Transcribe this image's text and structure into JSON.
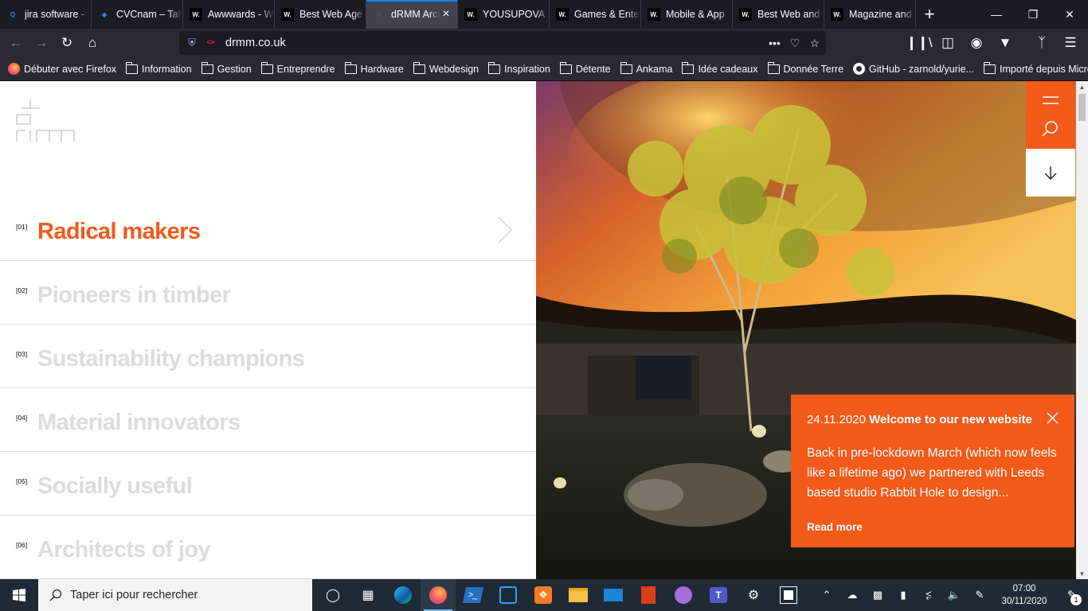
{
  "browser": {
    "tabs": [
      {
        "title": "jira software -",
        "fav_color": "#2684ff",
        "fav_text": "Q"
      },
      {
        "title": "CVCnam – Tal",
        "fav_color": "#2684ff",
        "fav_text": "◆"
      },
      {
        "title": "Awwwards - W",
        "fav_color": "#222222",
        "fav_text": "W."
      },
      {
        "title": "Best Web Age",
        "fav_color": "#222222",
        "fav_text": "W."
      },
      {
        "title": "dRMM Arch",
        "fav_color": "#555555",
        "fav_text": "d"
      },
      {
        "title": "YOUSUPOVA",
        "fav_color": "#222222",
        "fav_text": "W."
      },
      {
        "title": "Games & Ente",
        "fav_color": "#222222",
        "fav_text": "W."
      },
      {
        "title": "Mobile & App",
        "fav_color": "#222222",
        "fav_text": "W."
      },
      {
        "title": "Best Web and",
        "fav_color": "#222222",
        "fav_text": "W."
      },
      {
        "title": "Magazine and",
        "fav_color": "#222222",
        "fav_text": "W."
      }
    ],
    "active_tab": 4,
    "url": "drmm.co.uk",
    "bookmarks": [
      {
        "label": "Débuter avec Firefox",
        "icon": "firefox-icon"
      },
      {
        "label": "Information",
        "icon": "folder-icon"
      },
      {
        "label": "Gestion",
        "icon": "folder-icon"
      },
      {
        "label": "Entreprendre",
        "icon": "folder-icon"
      },
      {
        "label": "Hardware",
        "icon": "folder-icon"
      },
      {
        "label": "Webdesign",
        "icon": "folder-icon"
      },
      {
        "label": "Inspiration",
        "icon": "folder-icon"
      },
      {
        "label": "Détente",
        "icon": "folder-icon"
      },
      {
        "label": "Ankama",
        "icon": "folder-icon"
      },
      {
        "label": "Idée cadeaux",
        "icon": "folder-icon"
      },
      {
        "label": "Donnée Terre",
        "icon": "folder-icon"
      },
      {
        "label": "GitHub - zarnold/yurie...",
        "icon": "github-icon"
      },
      {
        "label": "Importé depuis Micros...",
        "icon": "folder-icon"
      }
    ]
  },
  "site": {
    "accent": "#f25a1a",
    "menu": [
      {
        "num": "[01]",
        "label": "Radical makers",
        "active": true
      },
      {
        "num": "[02]",
        "label": "Pioneers in timber",
        "active": false
      },
      {
        "num": "[03]",
        "label": "Sustainability champions",
        "active": false
      },
      {
        "num": "[04]",
        "label": "Material innovators",
        "active": false
      },
      {
        "num": "[05]",
        "label": "Socially useful",
        "active": false
      },
      {
        "num": "[06]",
        "label": "Architects of joy",
        "active": false
      }
    ],
    "news": {
      "date": "24.11.2020",
      "title": "Welcome to our new website",
      "body": "Back in pre-lockdown March (which now feels like a lifetime ago) we partnered with Leeds based studio Rabbit Hole to design...",
      "read_more": "Read more"
    }
  },
  "taskbar": {
    "search_placeholder": "Taper ici pour rechercher",
    "time": "07:00",
    "date": "30/11/2020",
    "notification_count": "1"
  }
}
